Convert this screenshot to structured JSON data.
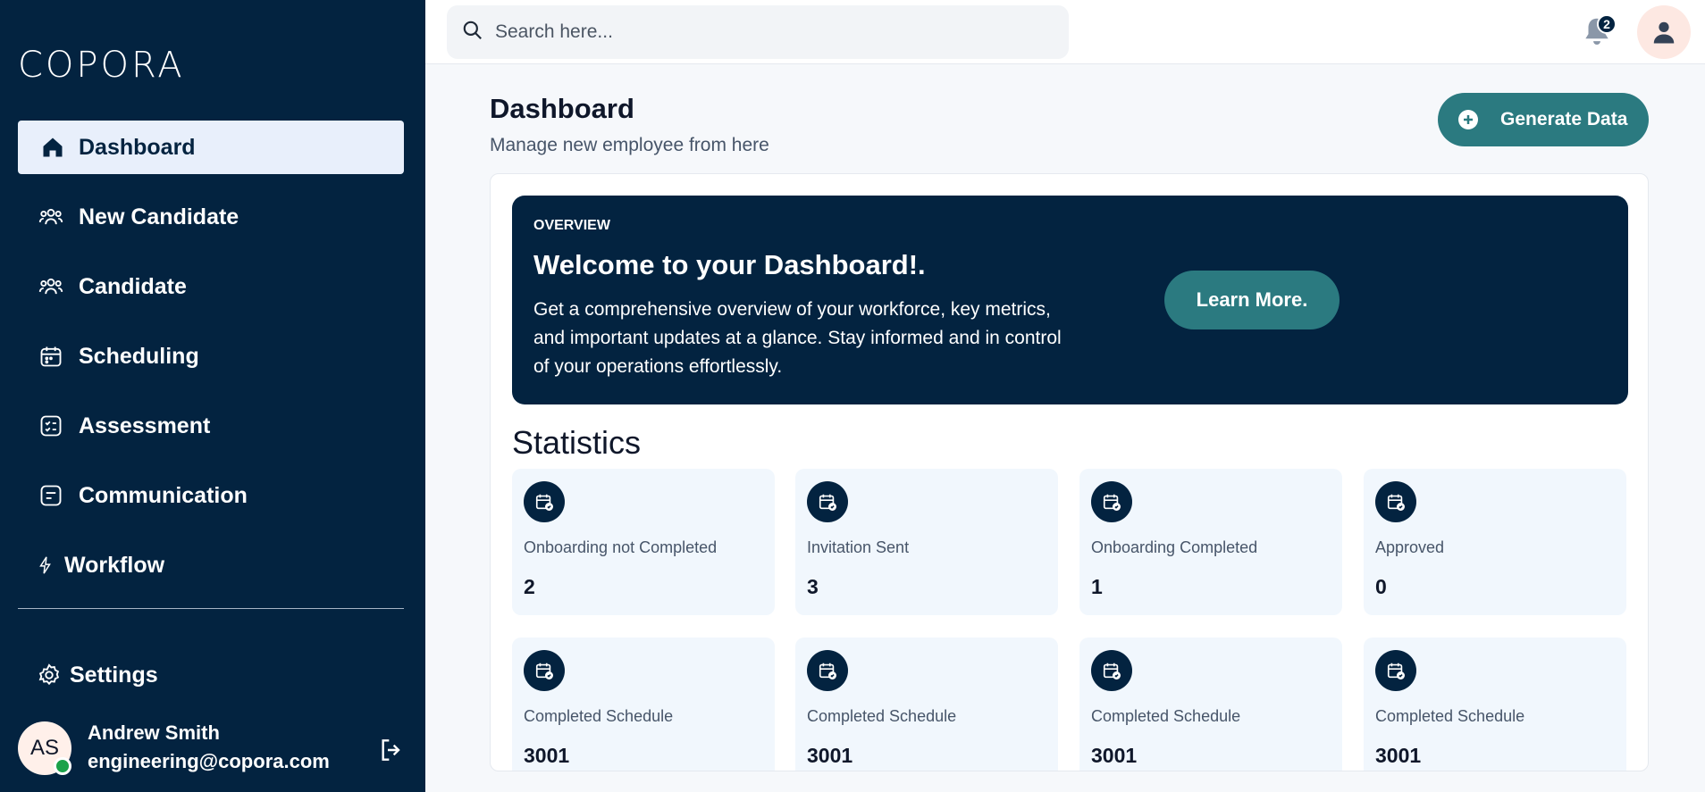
{
  "brand": {
    "logo_text": "COPORA"
  },
  "sidebar": {
    "items": [
      {
        "label": "Dashboard",
        "icon": "home-icon",
        "active": true
      },
      {
        "label": "New Candidate",
        "icon": "users-icon"
      },
      {
        "label": "Candidate",
        "icon": "users-icon"
      },
      {
        "label": "Scheduling",
        "icon": "calendar-icon"
      },
      {
        "label": "Assessment",
        "icon": "checklist-icon"
      },
      {
        "label": "Communication",
        "icon": "message-icon"
      },
      {
        "label": "Workflow",
        "icon": "bolt-icon"
      }
    ],
    "settings_label": "Settings"
  },
  "user": {
    "initials": "AS",
    "name": "Andrew Smith",
    "email": "engineering@copora.com",
    "status_color": "#1ba24a"
  },
  "topbar": {
    "search_placeholder": "Search here...",
    "notification_count": "2"
  },
  "header": {
    "title": "Dashboard",
    "subtitle": "Manage new employee from here",
    "generate_label": "Generate Data"
  },
  "overview": {
    "label": "OVERVIEW",
    "title": "Welcome to your Dashboard!.",
    "description": "Get a comprehensive overview of your workforce, key metrics, and important updates at a glance. Stay informed and in control of your operations effortlessly.",
    "learn_label": "Learn More."
  },
  "statistics": {
    "title": "Statistics",
    "cards": [
      {
        "label": "Onboarding not Completed",
        "value": "2"
      },
      {
        "label": "Invitation Sent",
        "value": "3"
      },
      {
        "label": "Onboarding Completed",
        "value": "1"
      },
      {
        "label": "Approved",
        "value": "0"
      },
      {
        "label": "Completed Schedule",
        "value": "3001"
      },
      {
        "label": "Completed Schedule",
        "value": "3001"
      },
      {
        "label": "Completed Schedule",
        "value": "3001"
      },
      {
        "label": "Completed Schedule",
        "value": "3001"
      }
    ]
  },
  "colors": {
    "sidebar_bg": "#032340",
    "accent": "#2b7a80",
    "active_item_bg": "#e8effb",
    "stat_card_bg": "#f1f7fd"
  }
}
